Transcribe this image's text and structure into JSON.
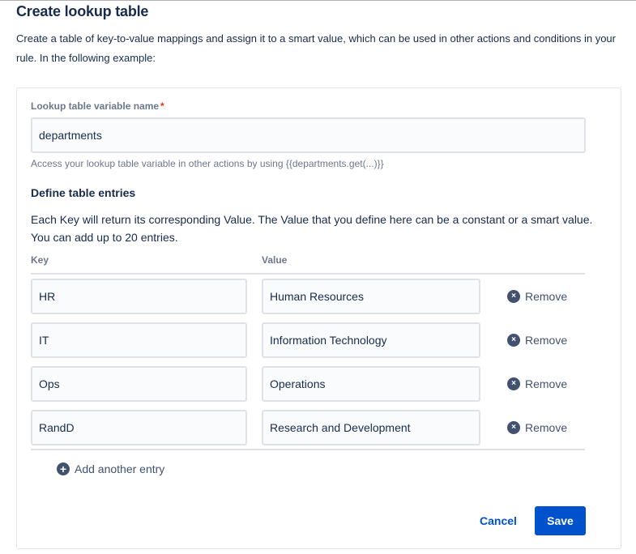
{
  "header": {
    "title": "Create lookup table",
    "description": "Create a table of key-to-value mappings and assign it to a smart value, which can be used in other actions and conditions in your rule. In the following example:"
  },
  "form": {
    "variable_label": "Lookup table variable name",
    "required_mark": "*",
    "variable_value": "departments",
    "helper_text": "Access your lookup table variable in other actions by using {{departments.get(...)}}",
    "section_title": "Define table entries",
    "section_description": "Each Key will return its corresponding Value. The Value that you define here can be a constant or a smart value. You can add up to 20 entries.",
    "key_header": "Key",
    "value_header": "Value",
    "entries": [
      {
        "key": "HR",
        "value": "Human Resources",
        "remove_label": "Remove"
      },
      {
        "key": "IT",
        "value": "Information Technology",
        "remove_label": "Remove"
      },
      {
        "key": "Ops",
        "value": "Operations",
        "remove_label": "Remove"
      },
      {
        "key": "RandD",
        "value": "Research and Development",
        "remove_label": "Remove"
      }
    ],
    "add_entry_label": "Add another entry",
    "cancel_label": "Cancel",
    "save_label": "Save"
  },
  "icons": {
    "remove": "remove-circle-icon",
    "add": "add-circle-icon"
  },
  "colors": {
    "primary": "#0052cc",
    "required": "#de350b",
    "text": "#172b4d",
    "subtle": "#6b778c"
  }
}
